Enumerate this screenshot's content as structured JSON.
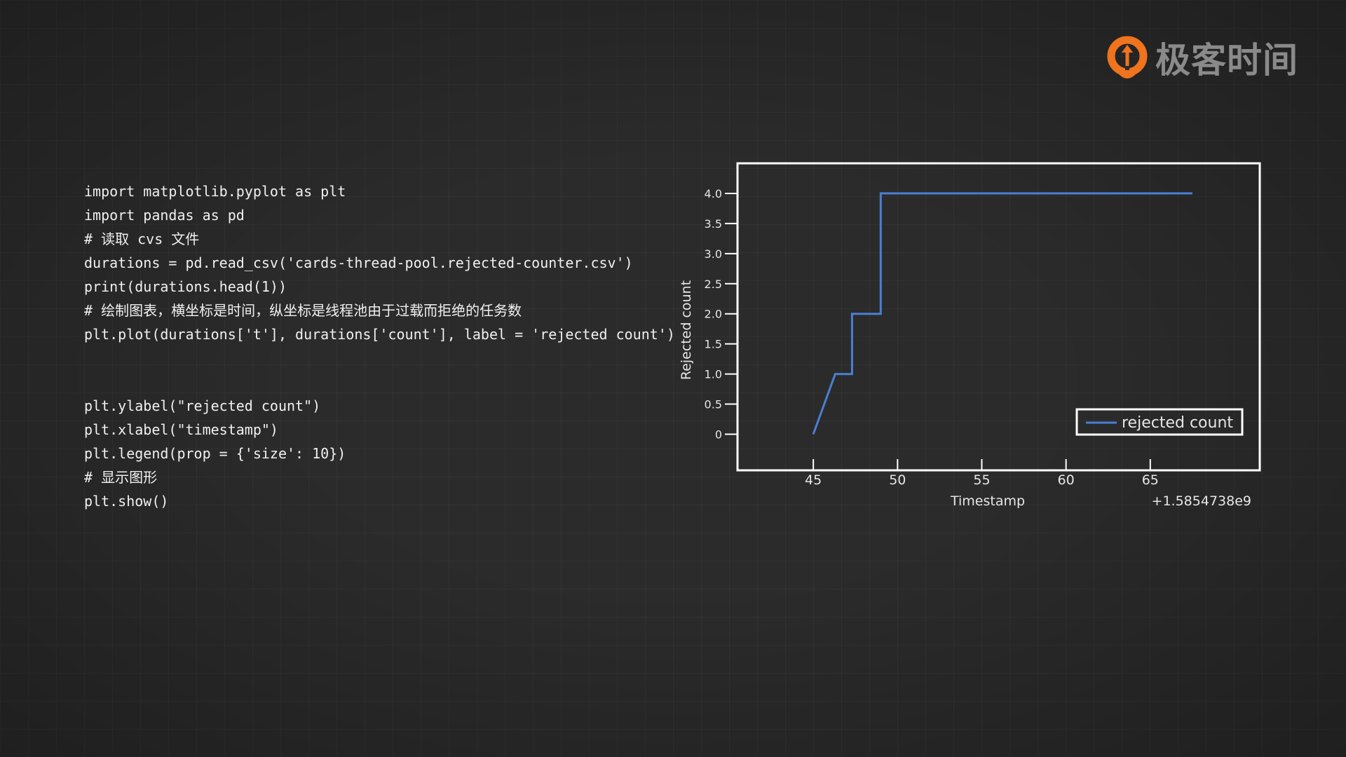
{
  "brand": {
    "logo_text": "极客时间",
    "icon": "geektime-logo-icon",
    "accent_color": "#f0731e"
  },
  "code": {
    "lines_top": [
      "import matplotlib.pyplot as plt",
      "import pandas as pd",
      "# 读取 cvs 文件",
      "durations = pd.read_csv('cards-thread-pool.rejected-counter.csv')",
      "print(durations.head(1))",
      "# 绘制图表，横坐标是时间，纵坐标是线程池由于过载而拒绝的任务数",
      "plt.plot(durations['t'], durations['count'], label = 'rejected count')"
    ],
    "lines_bottom": [
      "plt.ylabel(\"rejected count\")",
      "plt.xlabel(\"timestamp\")",
      "plt.legend(prop = {'size': 10})",
      "# 显示图形",
      "plt.show()"
    ]
  },
  "chart_data": {
    "type": "line",
    "xlabel": "Timestamp",
    "ylabel": "Rejected count",
    "x_offset_label": "+1.5854738e9",
    "xlim": [
      40.5,
      71.5
    ],
    "ylim": [
      -0.6,
      4.5
    ],
    "x_ticks": [
      45,
      50,
      55,
      60,
      65
    ],
    "x_tick_labels": [
      "45",
      "50",
      "55",
      "60",
      "65"
    ],
    "y_ticks": [
      0,
      0.5,
      1.0,
      1.5,
      2.0,
      2.5,
      3.0,
      3.5,
      4.0
    ],
    "y_tick_labels": [
      "0",
      "0.5",
      "1.0",
      "1.5",
      "2.0",
      "2.5",
      "3.0",
      "3.5",
      "4.0"
    ],
    "series": [
      {
        "name": "rejected count",
        "color": "#4a7fd4",
        "x": [
          45,
          46.3,
          47.3,
          47.3,
          49.0,
          49.0,
          67.5
        ],
        "y": [
          0,
          1.0,
          1.0,
          2.0,
          2.0,
          4.0,
          4.0
        ]
      }
    ],
    "legend": {
      "label": "rejected count",
      "position": "lower-right"
    },
    "grid": false
  }
}
